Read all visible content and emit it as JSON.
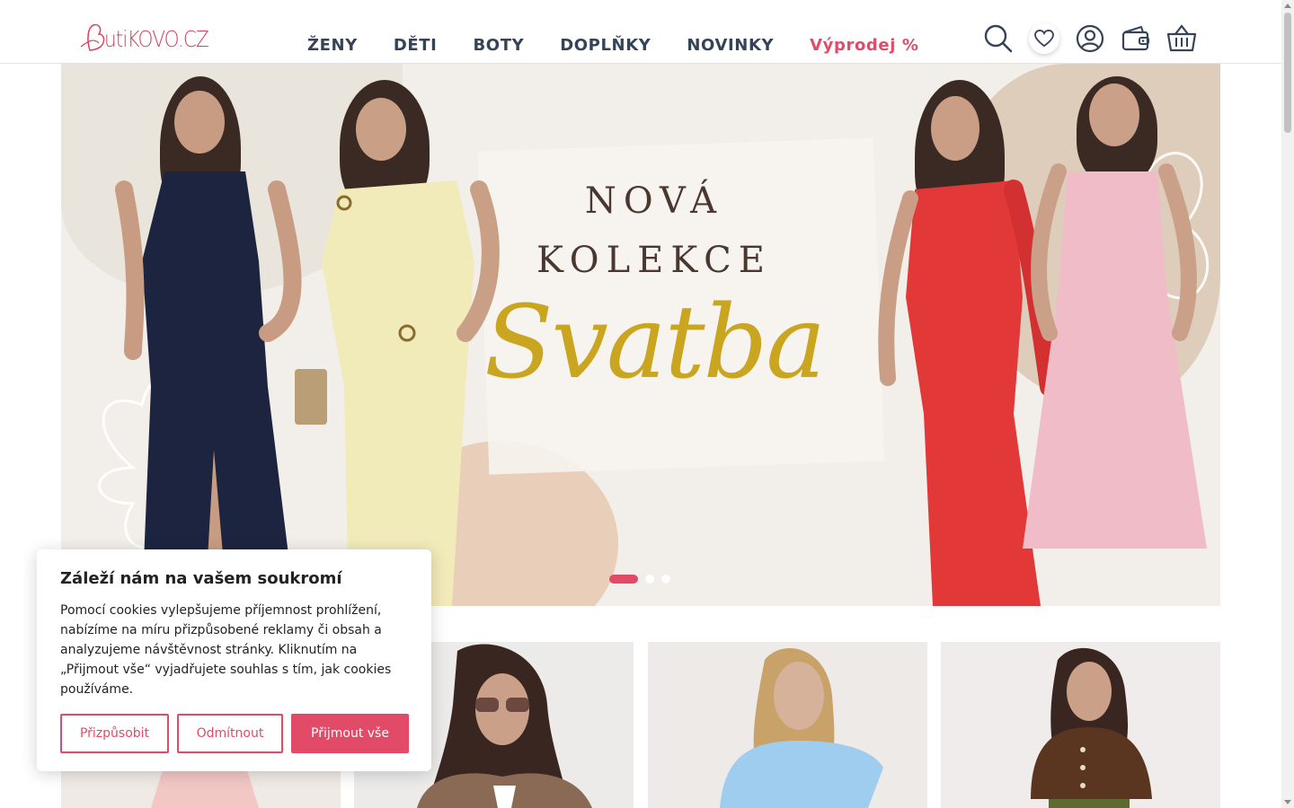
{
  "brand": {
    "logo_text": "utiKOVO.CZ",
    "accent": "#e24b68"
  },
  "nav": {
    "items": [
      "ŽENY",
      "DĚTI",
      "BOTY",
      "DOPLŇKY",
      "NOVINKY"
    ],
    "sale_label": "Výprodej %"
  },
  "header_icons": [
    "search-icon",
    "heart-icon",
    "user-icon",
    "wallet-icon",
    "basket-icon"
  ],
  "hero": {
    "line1": "NOVÁ",
    "line2": "KOLEKCE",
    "script": "Svatba",
    "slides": 3,
    "active_slide": 1
  },
  "cookie": {
    "title": "Záleží nám na vašem soukromí",
    "text": "Pomocí cookies vylepšujeme příjemnost prohlížení, nabízíme na míru přizpůsobené reklamy či obsah a analyzujeme návštěvnost stránky. Kliknutím na „Přijmout vše“ vyjadřujete souhlas s tím, jak cookies používáme.",
    "customize_label": "Přizpůsobit",
    "reject_label": "Odmítnout",
    "accept_label": "Přijmout vše"
  }
}
